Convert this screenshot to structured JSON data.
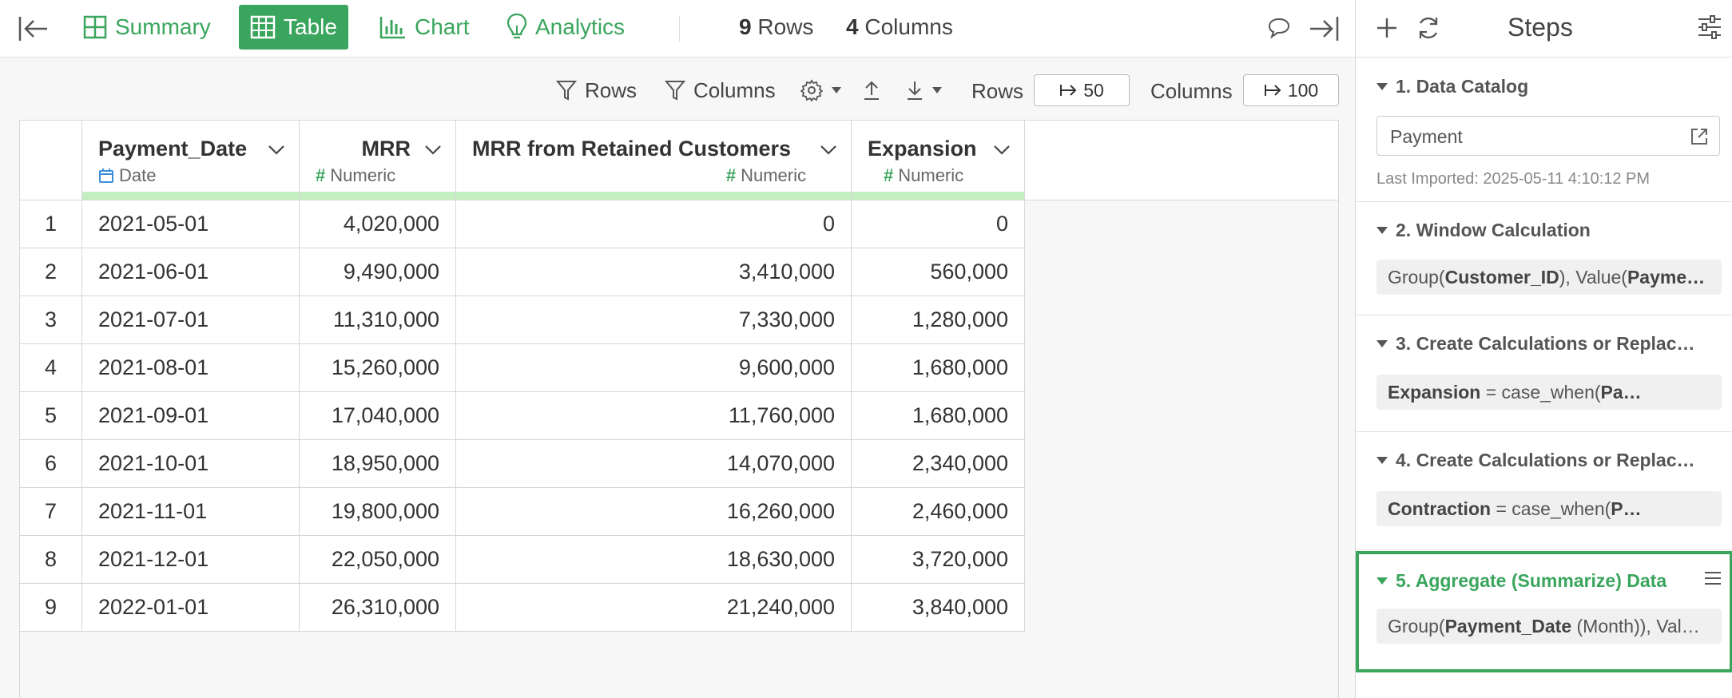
{
  "topbar": {
    "tabs": [
      {
        "label": "Summary",
        "icon": "summary-grid-icon",
        "active": false
      },
      {
        "label": "Table",
        "icon": "table-icon",
        "active": true
      },
      {
        "label": "Chart",
        "icon": "bar-chart-icon",
        "active": false
      },
      {
        "label": "Analytics",
        "icon": "lightbulb-icon",
        "active": false
      }
    ],
    "rows_count": "9",
    "rows_label": "Rows",
    "cols_count": "4",
    "cols_label": "Columns"
  },
  "toolbar": {
    "rows_filter_label": "Rows",
    "cols_filter_label": "Columns",
    "rows_limit_label": "Rows",
    "rows_limit_value": "50",
    "cols_limit_label": "Columns",
    "cols_limit_value": "100"
  },
  "table": {
    "columns": [
      {
        "name": "Payment_Date",
        "type": "Date",
        "type_icon": "calendar-icon"
      },
      {
        "name": "MRR",
        "type": "Numeric",
        "type_icon": "hash-icon"
      },
      {
        "name": "MRR from Retained Customers",
        "type": "Numeric",
        "type_icon": "hash-icon"
      },
      {
        "name": "Expansion",
        "type": "Numeric",
        "type_icon": "hash-icon"
      }
    ],
    "rows": [
      [
        "1",
        "2021-05-01",
        "4,020,000",
        "0",
        "0"
      ],
      [
        "2",
        "2021-06-01",
        "9,490,000",
        "3,410,000",
        "560,000"
      ],
      [
        "3",
        "2021-07-01",
        "11,310,000",
        "7,330,000",
        "1,280,000"
      ],
      [
        "4",
        "2021-08-01",
        "15,260,000",
        "9,600,000",
        "1,680,000"
      ],
      [
        "5",
        "2021-09-01",
        "17,040,000",
        "11,760,000",
        "1,680,000"
      ],
      [
        "6",
        "2021-10-01",
        "18,950,000",
        "14,070,000",
        "2,340,000"
      ],
      [
        "7",
        "2021-11-01",
        "19,800,000",
        "16,260,000",
        "2,460,000"
      ],
      [
        "8",
        "2021-12-01",
        "22,050,000",
        "18,630,000",
        "3,720,000"
      ],
      [
        "9",
        "2022-01-01",
        "26,310,000",
        "21,240,000",
        "3,840,000"
      ]
    ]
  },
  "steps": {
    "title": "Steps",
    "items": [
      {
        "title": "1. Data Catalog",
        "source": "Payment",
        "last_imported": "Last Imported: 2025-05-11 4:10:12 PM"
      },
      {
        "title": "2. Window Calculation",
        "body_pre": "Group(",
        "body_b1": "Customer_ID",
        "body_mid": "), Value(",
        "body_b2": "Payme…"
      },
      {
        "title": "3. Create Calculations or Replac…",
        "body_b1": "Expansion",
        "body_mid": " = case_when(",
        "body_b2": "Pa…"
      },
      {
        "title": "4. Create Calculations or Replac…",
        "body_b1": "Contraction",
        "body_mid": " = case_when(",
        "body_b2": "P…"
      },
      {
        "title": "5. Aggregate (Summarize) Data",
        "body_pre": "Group(",
        "body_b1": "Payment_Date",
        "body_mid": " (Month)), Val…"
      }
    ]
  },
  "colors": {
    "accent": "#3aa55d",
    "type_bar": "#c4efc0",
    "date_icon": "#3b8fd8"
  }
}
